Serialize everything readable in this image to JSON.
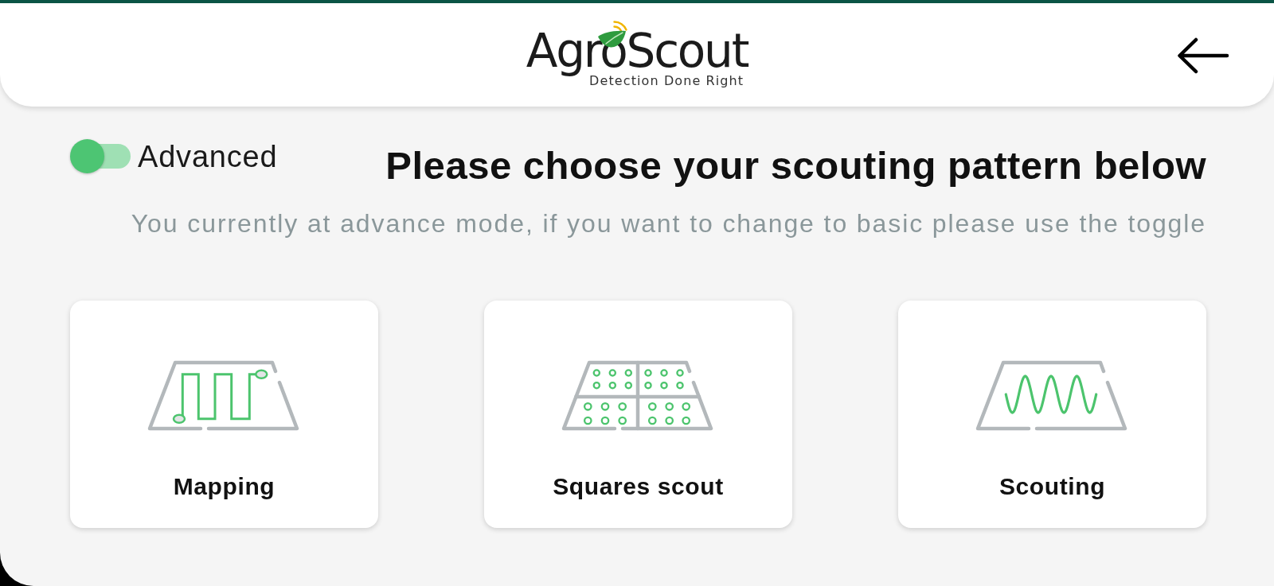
{
  "header": {
    "logo": {
      "name": "AgroScout",
      "tagline": "Detection Done Right"
    }
  },
  "mode_toggle": {
    "label": "Advanced",
    "on": true
  },
  "title": "Please choose your scouting pattern below",
  "subtitle": "You currently at advance mode, if you want to change to basic please use the toggle",
  "patterns": [
    {
      "kind": "mapping",
      "label": "Mapping"
    },
    {
      "kind": "squares",
      "label": "Squares scout"
    },
    {
      "kind": "scouting",
      "label": "Scouting"
    }
  ]
}
